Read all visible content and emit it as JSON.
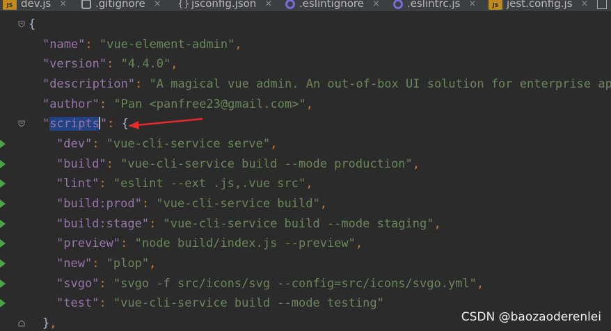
{
  "tabs": [
    {
      "label": "dev.js",
      "icon": "js-file-icon"
    },
    {
      "label": ".gitignore",
      "icon": "git-file-icon"
    },
    {
      "label": "jsconfig.json",
      "icon": "json-file-icon"
    },
    {
      "label": ".eslintignore",
      "icon": "eslint-file-icon"
    },
    {
      "label": ".eslintrc.js",
      "icon": "eslint-file-icon"
    },
    {
      "label": "jest.config.js",
      "icon": "js-file-icon"
    }
  ],
  "tab_close_glyph": "×",
  "js_icon_text": "JS",
  "code": {
    "open_brace": "{",
    "top": [
      {
        "key": "\"name\"",
        "value": "\"vue-element-admin\""
      },
      {
        "key": "\"version\"",
        "value": "\"4.4.0\""
      },
      {
        "key": "\"description\"",
        "value": "\"A magical vue admin. An out-of-box UI solution for enterprise appl"
      },
      {
        "key": "\"author\"",
        "value": "\"Pan <panfree23@gmail.com>\""
      }
    ],
    "scripts_key_open": "\"",
    "scripts_key_word": "scripts",
    "scripts_key_close": "\"",
    "scripts_open": "{",
    "scripts": [
      {
        "key": "\"dev\"",
        "value": "\"vue-cli-service serve\""
      },
      {
        "key": "\"build\"",
        "value": "\"vue-cli-service build --mode production\""
      },
      {
        "key": "\"lint\"",
        "value": "\"eslint --ext .js,.vue src\""
      },
      {
        "key": "\"build:prod\"",
        "value": "\"vue-cli-service build\""
      },
      {
        "key": "\"build:stage\"",
        "value": "\"vue-cli-service build --mode staging\""
      },
      {
        "key": "\"preview\"",
        "value": "\"node build/index.js --preview\""
      },
      {
        "key": "\"new\"",
        "value": "\"plop\""
      },
      {
        "key": "\"svgo\"",
        "value": "\"svgo -f src/icons/svg --config=src/icons/svgo.yml\""
      },
      {
        "key": "\"test\"",
        "value": "\"vue-cli-service build --mode testing\""
      }
    ],
    "close_brace": "}",
    "colon": ": ",
    "comma": ","
  },
  "watermark": "CSDN @baozaoderenlei",
  "colors": {
    "background": "#2b2b2b",
    "key": "#9876aa",
    "string": "#6a8759",
    "punctuation": "#cc7832",
    "selection": "#214283",
    "run_marker": "#4fa14b",
    "annotation_arrow": "#e8292d"
  }
}
